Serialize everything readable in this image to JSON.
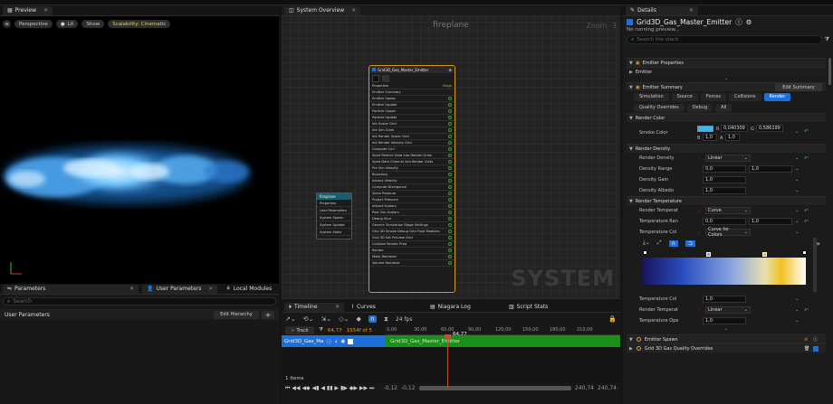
{
  "preview": {
    "tab_label": "Preview",
    "toolbar": {
      "perspective": "Perspective",
      "lit": "Lit",
      "show": "Show",
      "scalability": "Scalability: Cinematic"
    }
  },
  "parameters": {
    "tabs": [
      "Parameters",
      "User Parameters",
      "Local Modules"
    ],
    "search_placeholder": "Search",
    "section_label": "User Parameters",
    "edit_hierarchy": "Edit Hierarchy",
    "add": "+"
  },
  "system_overview": {
    "tab_label": "System Overview",
    "graph_title": "fireplane",
    "zoom": "Zoom -3",
    "watermark": "SYSTEM",
    "emitter_node": {
      "title": "Grid3D_Gas_Master_Emitter",
      "rows": [
        "Properties",
        "Emitter Summary",
        "Emitter Spawn",
        "Emitter Update",
        "Particle Spawn",
        "Particle Update",
        "Init Scalar Grid",
        "Init Sim Grids",
        "Init Render Scalar Grid",
        "Init Render Velocity Grid",
        "Compute Curl",
        "Splat Particle Data into Render Grids",
        "Splat Data Channel into Render Grids",
        "Pre Sim Velocity",
        "Boundary",
        "Advect Velocity",
        "Compute Divergence",
        "Solve Pressure",
        "Project Pressure",
        "Advect Scalars",
        "Post Sim Scalars",
        "Debug Slice",
        "Generic Simulation Stage Settings",
        "Grid 3D Smoke Debug Grid Fluid Modules",
        "Grid 3D Set Preview Grid",
        "Collision Render Prep",
        "Render",
        "Mesh Renderer",
        "Volume Renderer"
      ],
      "stage_label": "Stage"
    },
    "system_node": {
      "title": "fireplane",
      "rows": [
        "Properties",
        "User Parameters",
        "System Spawn",
        "System Update",
        "System State"
      ]
    }
  },
  "timeline": {
    "tabs": [
      "Timeline",
      "Curves",
      "Niagara Log",
      "Script Stats"
    ],
    "fps": "24 fps",
    "add_track": "Track",
    "current_time": "64,77",
    "frame_info": "1554f of 5",
    "playhead_label": "64,77",
    "ruler": [
      "0,00",
      "30,00",
      "60,00",
      "90,00",
      "120,00",
      "150,00",
      "180,00",
      "210,00"
    ],
    "track_name": "Grid3D_Gas_Ma",
    "bar_label": "Grid3D_Gas_Master_Emitter",
    "items_count": "1 items",
    "range_start": "-0,12",
    "range_start2": "-0,12",
    "range_end": "240,74",
    "range_end2": "240,74"
  },
  "details": {
    "tab_label": "Details",
    "emitter_name": "Grid3D_Gas_Master_Emitter",
    "preview_status": "No running preview...",
    "search_placeholder": "Search the stack",
    "emitter_properties": "Emitter Properties",
    "emitter": "Emitter",
    "emitter_summary": "Emitter Summary",
    "edit_summary": "Edit Summary",
    "category_tabs": [
      "Simulation",
      "Source",
      "Forces",
      "Collisions",
      "Render"
    ],
    "sub_tabs": [
      "Quality Overrides",
      "Debug",
      "All"
    ],
    "render_color": {
      "section": "Render Color",
      "label": "Smoke Color",
      "r_label": "R",
      "r": "0,040309",
      "g_label": "G",
      "g": "0,586199",
      "b_label": "B",
      "b": "1,0",
      "a_label": "A",
      "a": "1,0",
      "swatch": "#3fb6f2"
    },
    "render_density": {
      "section": "Render Density",
      "rows": [
        {
          "label": "Render Density",
          "value": "Linear"
        },
        {
          "label": "Density Range",
          "value": "0,0",
          "value2": "1,0"
        },
        {
          "label": "Density Gain",
          "value": "1,0"
        },
        {
          "label": "Density Albedo",
          "value": "1,0"
        }
      ]
    },
    "render_temperature": {
      "section": "Render Temperature",
      "rows": [
        {
          "label": "Render Temperat",
          "value": "Curve"
        },
        {
          "label": "Temperature Ran",
          "value": "0,0",
          "value2": "1,0"
        },
        {
          "label": "Temperature Col",
          "value": "Curve for Colors"
        },
        {
          "label": "Temperature Col",
          "value": "1,0"
        },
        {
          "label": "Render Temperat",
          "value": "Linear"
        },
        {
          "label": "Temperature Ope",
          "value": "1,0"
        }
      ]
    },
    "bottom_sections": [
      "Emitter Spawn",
      "Grid 3D Gas Quality Overrides"
    ],
    "accent": "#1f6fd8"
  }
}
